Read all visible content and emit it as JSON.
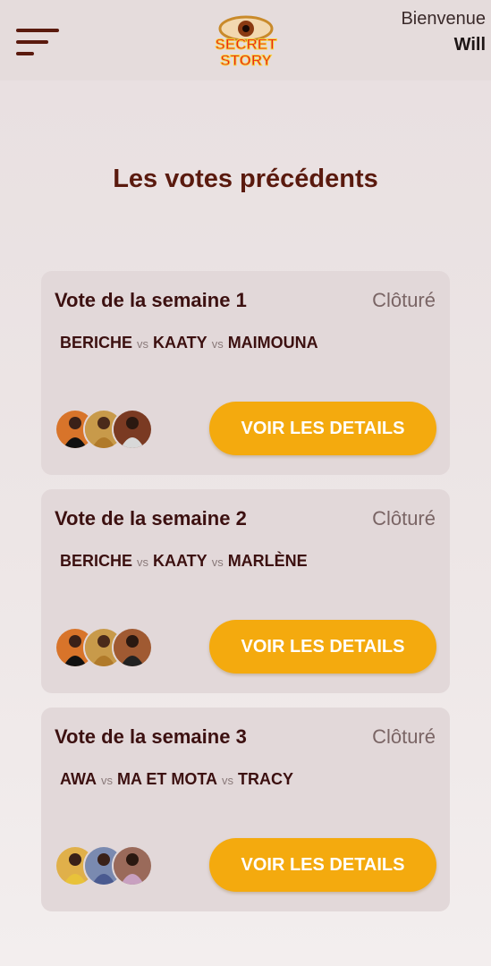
{
  "header": {
    "logo_line1": "SECRET",
    "logo_line2": "STORY",
    "welcome_label": "Bienvenue",
    "user_name": "Will"
  },
  "page": {
    "title": "Les votes précédents"
  },
  "colors": {
    "primary_brown": "#5a1a0e",
    "button_orange": "#f4aa0e",
    "card_bg": "#e2d8d9"
  },
  "votes": [
    {
      "title": "Vote de la semaine 1",
      "status": "Clôturé",
      "candidates": [
        "BERICHE",
        "KAATY",
        "MAIMOUNA"
      ],
      "separator": "vs",
      "button_label": "VOIR LES DETAILS"
    },
    {
      "title": "Vote de la semaine 2",
      "status": "Clôturé",
      "candidates": [
        "BERICHE",
        "KAATY",
        "MARLÈNE"
      ],
      "separator": "vs",
      "button_label": "VOIR LES DETAILS"
    },
    {
      "title": "Vote de la semaine 3",
      "status": "Clôturé",
      "candidates": [
        "AWA",
        "MA ET MOTA",
        "TRACY"
      ],
      "separator": "vs",
      "button_label": "VOIR LES DETAILS"
    }
  ]
}
